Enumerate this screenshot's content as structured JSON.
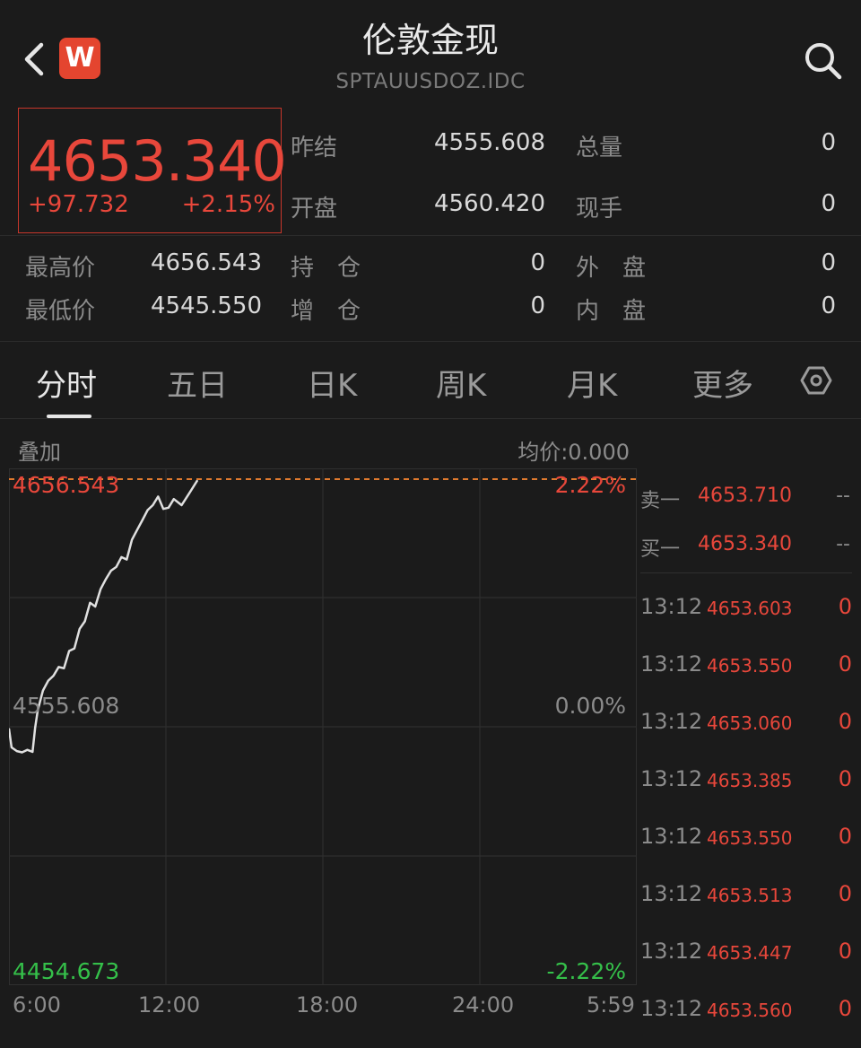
{
  "header": {
    "title": "伦敦金现",
    "subtitle": "SPTAUUSDOZ.IDC",
    "logo_letter": "W"
  },
  "quote": {
    "price": "4653.340",
    "change": "+97.732",
    "change_pct": "+2.15%"
  },
  "stats": [
    {
      "label": "昨结",
      "value": "4555.608"
    },
    {
      "label": "开盘",
      "value": "4560.420"
    },
    {
      "label": "总量",
      "value": "0"
    },
    {
      "label": "现手",
      "value": "0"
    },
    {
      "label": "最高价",
      "value": "4656.543"
    },
    {
      "label": "最低价",
      "value": "4545.550"
    },
    {
      "label": "持　仓",
      "value": "0"
    },
    {
      "label": "增　仓",
      "value": "0"
    },
    {
      "label": "外　盘",
      "value": "0"
    },
    {
      "label": "内　盘",
      "value": "0"
    }
  ],
  "tabs": [
    "分时",
    "五日",
    "日K",
    "周K",
    "月K",
    "更多"
  ],
  "chart_header": {
    "overlay_label": "叠加",
    "avg_label": "均价:0.000"
  },
  "chart_data": {
    "type": "line",
    "y_top_label": "4656.543",
    "y_mid_label": "4555.608",
    "y_bottom_label": "4454.673",
    "pct_top_label": "2.22%",
    "pct_mid_label": "0.00%",
    "pct_bottom_label": "-2.22%",
    "ylim": [
      4454.673,
      4656.543
    ],
    "reference_line": 4656.543,
    "x_ticks": [
      "6:00",
      "12:00",
      "18:00",
      "24:00",
      "5:59"
    ],
    "x_range_hours": [
      0,
      24
    ],
    "series": [
      {
        "x": [
          0,
          0.1,
          0.3,
          0.5,
          0.7,
          0.9,
          1.0,
          1.1,
          1.3,
          1.5,
          1.7,
          1.9,
          2.1,
          2.3,
          2.5,
          2.7,
          2.9,
          3.1,
          3.3,
          3.5,
          3.7,
          3.9,
          4.1,
          4.3,
          4.5,
          4.7,
          4.9,
          5.1,
          5.3,
          5.5,
          5.7,
          5.9,
          6.1,
          6.3,
          6.6,
          6.9,
          7.2
        ],
        "values": [
          4555.6,
          4548.0,
          4546.5,
          4546.0,
          4547.0,
          4546.2,
          4556.0,
          4563.0,
          4571.0,
          4575.0,
          4577.0,
          4580.5,
          4580.0,
          4587.0,
          4588.0,
          4596.0,
          4599.0,
          4606.5,
          4605.0,
          4612.0,
          4616.0,
          4619.5,
          4621.0,
          4625.0,
          4624.0,
          4632.0,
          4636.0,
          4640.0,
          4644.0,
          4646.0,
          4649.5,
          4644.5,
          4645.0,
          4648.5,
          4646.0,
          4651.0,
          4656.0
        ]
      }
    ]
  },
  "order_book": {
    "sell_label": "卖一",
    "sell_price": "4653.710",
    "sell_vol": "--",
    "buy_label": "买一",
    "buy_price": "4653.340",
    "buy_vol": "--"
  },
  "ticks": [
    {
      "time": "13:12",
      "price": "4653.603",
      "vol": "0"
    },
    {
      "time": "13:12",
      "price": "4653.550",
      "vol": "0"
    },
    {
      "time": "13:12",
      "price": "4653.060",
      "vol": "0"
    },
    {
      "time": "13:12",
      "price": "4653.385",
      "vol": "0"
    },
    {
      "time": "13:12",
      "price": "4653.550",
      "vol": "0"
    },
    {
      "time": "13:12",
      "price": "4653.513",
      "vol": "0"
    },
    {
      "time": "13:12",
      "price": "4653.447",
      "vol": "0"
    },
    {
      "time": "13:12",
      "price": "4653.560",
      "vol": "0"
    }
  ],
  "colors": {
    "up": "#e8473b",
    "down": "#35c04a",
    "background": "#1b1b1b",
    "line": "#e0e0e0",
    "reference_line": "#e07a2e"
  },
  "icons": {
    "back": "chevron-left-icon",
    "search": "search-icon",
    "settings": "hexagon-settings-icon"
  }
}
